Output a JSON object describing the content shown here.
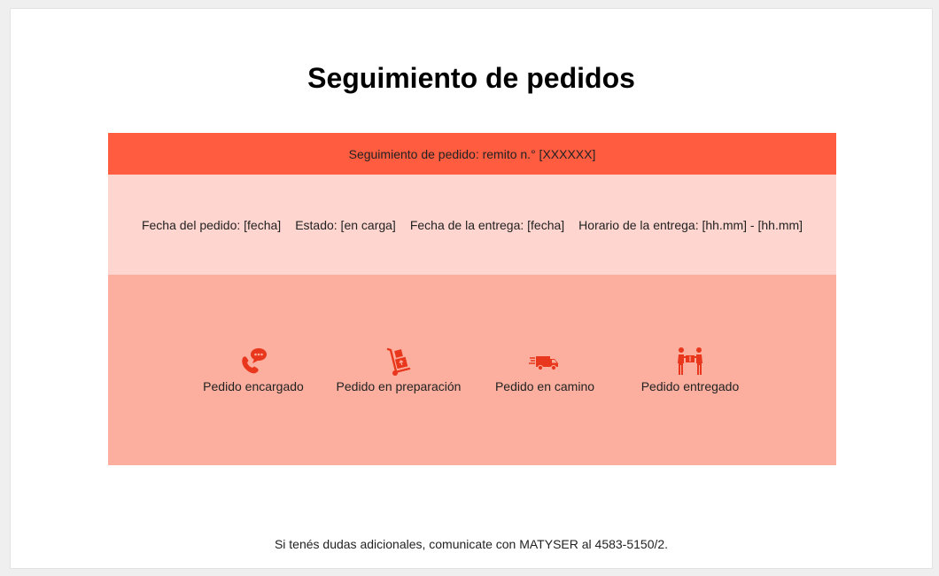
{
  "title": "Seguimiento de pedidos",
  "header": {
    "label": "Seguimiento de pedido: remito n.° [XXXXXX]"
  },
  "info": {
    "fecha_pedido": "Fecha del pedido: [fecha]",
    "estado": "Estado: [en carga]",
    "fecha_entrega": "Fecha de la entrega: [fecha]",
    "horario": "Horario de la entrega: [hh.mm] - [hh.mm]"
  },
  "steps": [
    {
      "label": "Pedido encargado",
      "icon": "phone-chat-icon"
    },
    {
      "label": "Pedido en preparación",
      "icon": "hand-truck-icon"
    },
    {
      "label": "Pedido en camino",
      "icon": "delivery-truck-icon"
    },
    {
      "label": "Pedido entregado",
      "icon": "handover-icon"
    }
  ],
  "footer": "Si tenés dudas adicionales, comunicate con MATYSER al 4583-5150/2.",
  "colors": {
    "accent": "#ff5c40",
    "info_band": "#ffd5cf",
    "steps_band": "#fdaf9f",
    "icon": "#e8371c"
  }
}
